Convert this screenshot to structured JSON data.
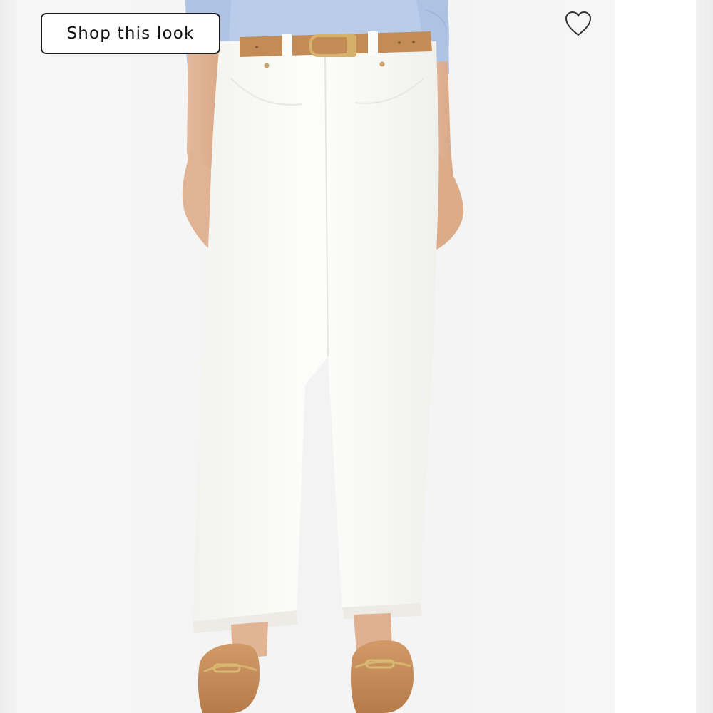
{
  "product_view": {
    "shop_look_label": "Shop this look",
    "favorite_icon": "heart-outline-icon",
    "photo_subject": "model-wearing-white-wide-leg-jeans"
  },
  "colors": {
    "button_border": "#1a1a1a",
    "jeans": "#fbfbf8",
    "belt": "#c08a55",
    "loafers": "#c48a57",
    "sweater": "#b8cbe8",
    "background": "#f5f5f5"
  }
}
